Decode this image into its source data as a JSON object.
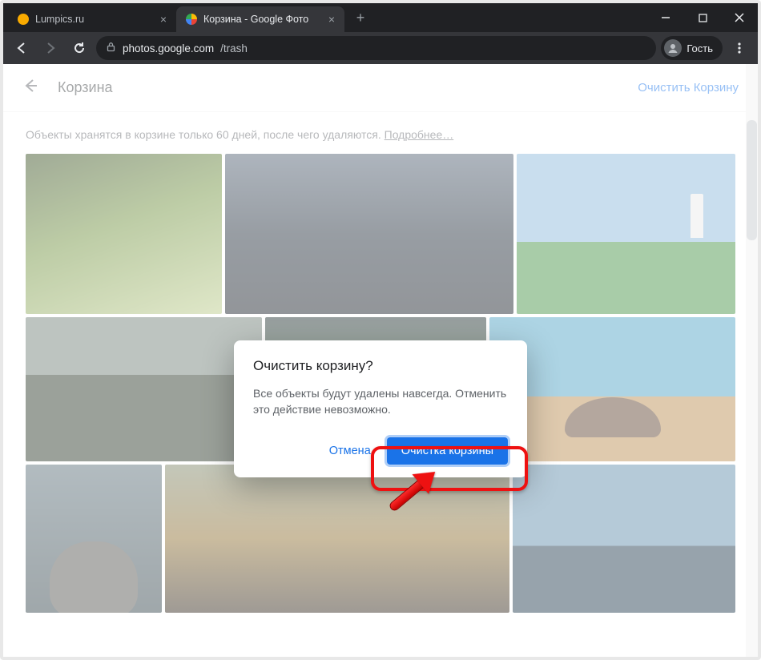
{
  "browser": {
    "tabs": [
      {
        "title": "Lumpics.ru",
        "favicon": "fav-lumpics",
        "active": false
      },
      {
        "title": "Корзина - Google Фото",
        "favicon": "fav-gphotos",
        "active": true
      }
    ],
    "url_host": "photos.google.com",
    "url_path": "/trash",
    "guest_label": "Гость"
  },
  "page": {
    "back_icon": "←",
    "title": "Корзина",
    "empty_button": "Очистить Корзину",
    "info_text": "Объекты хранятся в корзине только 60 дней, после чего удаляются. ",
    "info_more": "Подробнее…"
  },
  "dialog": {
    "title": "Очистить корзину?",
    "body": "Все объекты будут удалены навсегда. Отменить это действие невозможно.",
    "cancel": "Отмена",
    "confirm": "Очистка корзины"
  }
}
